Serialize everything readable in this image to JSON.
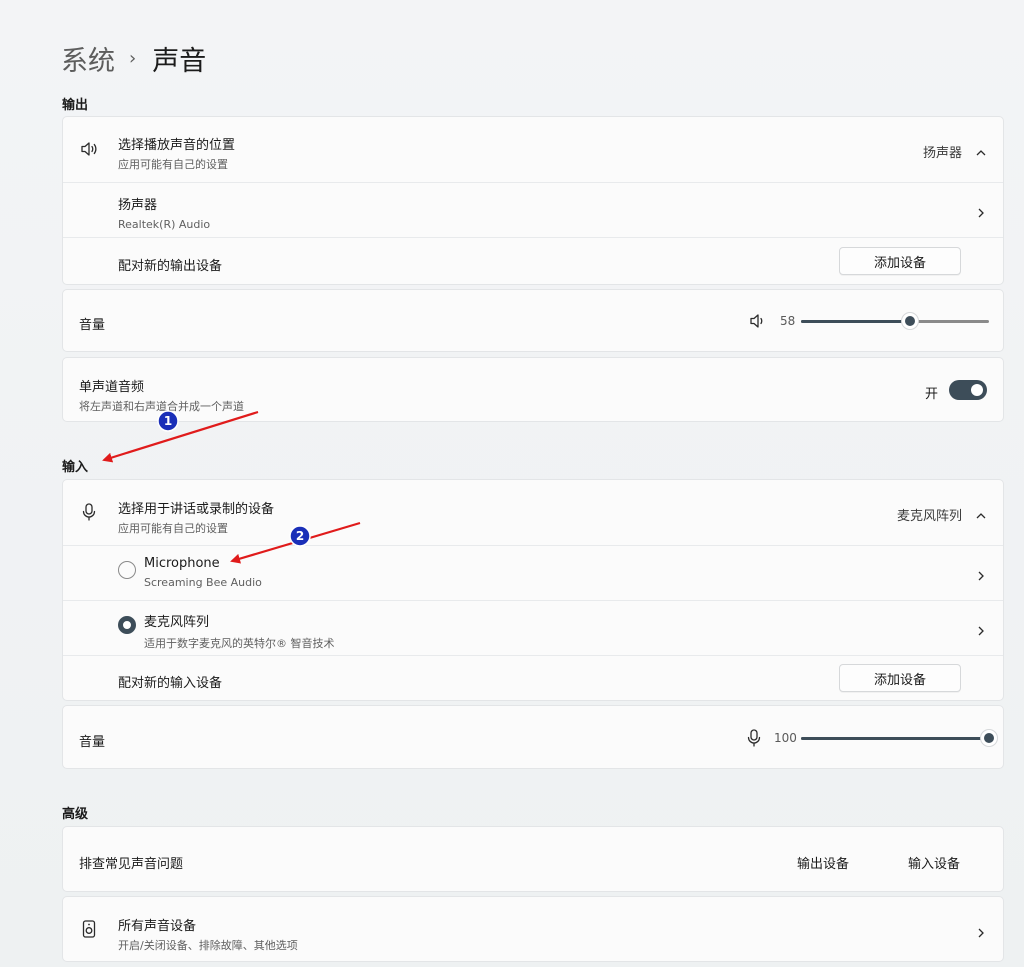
{
  "breadcrumb": {
    "parent": "系统",
    "separator": "›",
    "current": "声音"
  },
  "output": {
    "label": "输出",
    "choose": {
      "title": "选择播放声音的位置",
      "subtitle": "应用可能有自己的设置",
      "value": "扬声器"
    },
    "device": {
      "name": "扬声器",
      "detail": "Realtek(R) Audio"
    },
    "pair": {
      "label": "配对新的输出设备",
      "button": "添加设备"
    },
    "volume": {
      "label": "音量",
      "value": "58",
      "level_percent": 58
    },
    "mono": {
      "title": "单声道音频",
      "subtitle": "将左声道和右声道合并成一个声道",
      "state": "开"
    }
  },
  "input": {
    "label": "输入",
    "choose": {
      "title": "选择用于讲话或录制的设备",
      "subtitle": "应用可能有自己的设置",
      "value": "麦克风阵列"
    },
    "devices": [
      {
        "name": "Microphone",
        "detail": "Screaming Bee Audio",
        "selected": false
      },
      {
        "name": "麦克风阵列",
        "detail": "适用于数字麦克风的英特尔® 智音技术",
        "selected": true
      }
    ],
    "pair": {
      "label": "配对新的输入设备",
      "button": "添加设备"
    },
    "volume": {
      "label": "音量",
      "value": "100",
      "level_percent": 100
    }
  },
  "advanced": {
    "label": "高级",
    "troubleshoot": {
      "title": "排查常见声音问题",
      "output_link": "输出设备",
      "input_link": "输入设备"
    },
    "all_devices": {
      "title": "所有声音设备",
      "subtitle": "开启/关闭设备、排除故障、其他选项"
    }
  },
  "annotations": {
    "badge1": "1",
    "badge2": "2"
  },
  "colors": {
    "accent": "#3d4d59",
    "arrow": "#e01b1b",
    "badge": "#1a2fb8"
  }
}
